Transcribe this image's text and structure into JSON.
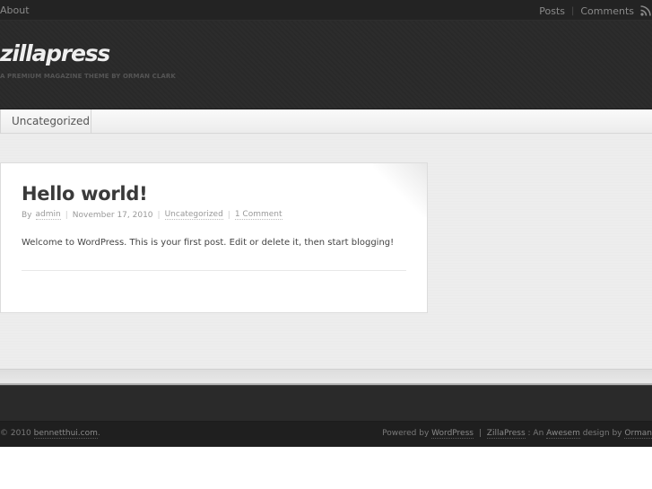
{
  "topbar": {
    "about": "About",
    "posts": "Posts",
    "comments": "Comments",
    "separator": "|"
  },
  "header": {
    "logo": "zillapress",
    "tagline": "A PREMIUM MAGAZINE THEME BY ORMAN CLARK"
  },
  "nav": {
    "items": [
      {
        "label": "Uncategorized"
      }
    ]
  },
  "post": {
    "title": "Hello world!",
    "meta": {
      "by": "By",
      "author": "admin",
      "date": "November 17, 2010",
      "category": "Uncategorized",
      "comments": "1 Comment",
      "separator": "|"
    },
    "body": "Welcome to WordPress. This is your first post. Edit or delete it, then start blogging!"
  },
  "footer": {
    "copyright_prefix": "© 2010",
    "site_link": "bennetthui.com",
    "copyright_suffix": ".",
    "powered_by": "Powered by",
    "wordpress": "WordPress",
    "pipe": "|",
    "theme": "ZillaPress",
    "design_text": ": An",
    "awesem": "Awesem",
    "design_by": "design by",
    "designer": "Orman"
  },
  "colors": {
    "topbar_bg": "#232323",
    "header_bg": "#2a2a2a",
    "content_bg": "#ededed",
    "footer_bg": "#1f1f1f"
  }
}
